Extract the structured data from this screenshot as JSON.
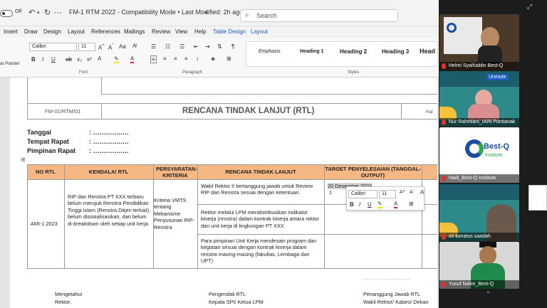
{
  "titlebar": {
    "autosave": "Off",
    "doc_title": "FM-1 RTM 2022  -  Compatibility Mode  •  Last Modified: 2h ago",
    "search_placeholder": "Search"
  },
  "menu": [
    "Insert",
    "Draw",
    "Design",
    "Layout",
    "References",
    "Mailings",
    "Review",
    "View",
    "Help",
    "Table Design",
    "Layout"
  ],
  "ribbon": {
    "format_painter": "at Painter",
    "font_name": "Calibri",
    "font_size": "11",
    "group_font": "Font",
    "group_paragraph": "Paragraph",
    "group_styles": "Styles",
    "styles": [
      "Emphasis",
      "Heading 1",
      "Heading 2",
      "Heading 3",
      "Head"
    ]
  },
  "doc": {
    "form_code": "FM-01/RTM/01",
    "form_title": "RENCANA TINDAK LANJUT (RTL)",
    "hal": "Hal",
    "fields": [
      {
        "label": "Tanggal",
        "value": ": ………….…."
      },
      {
        "label": "Tempat Rapat",
        "value": ": ………….…."
      },
      {
        "label": "Pimpinan Rapat",
        "value": ": ………….…."
      }
    ],
    "headers": [
      "NO RTL",
      "KENDALA/ RTL",
      "PERSYARATAN-KRITERIA",
      "RENCANA TINDAK LANJUT",
      "TARGET PENYELESAIAN (TANGGAL-OUTPUT)"
    ],
    "row": {
      "no": "AMI-1.2023",
      "kendala_1": "RIP dan Renstra PT XXX terbaru belum merujuk Renstra Pendidikan Tinggi Islam (Renstra Ditjen terkait), belum disosialisasikan, dan belum di-",
      "kendala_em": "breakdown",
      "kendala_2": " oleh setiap unit kerja.",
      "kriteria": "Kriteria VMTS tentang Mekanisme Penyusunan RIP-Renstra",
      "rencana": [
        "Wakil Rektor II bertanggung jawab untuk Review RIP dan Renstra sesuai dengan ketentuan.",
        "Rektor melalui LPM mendistribusikan indikator kinerja (renstra) dalam kontrak kinerja antara rektor dan unit kerja di lingkungan PT XXX",
        "Para pimpinan Unit Kerja mendesain program dan kegiatan sesuai dengan kontrak kinerja dalam renstra masing-masing (fakultas, Lembaga dan UPT)"
      ],
      "target": "20 Desember 2023",
      "target_2": "1"
    },
    "dots": "……  ……………………..",
    "signatures": [
      {
        "line1": "Mengetahui",
        "line2": "Rektor,"
      },
      {
        "line1": "Pengendali RTL",
        "line2": "Kepala SPI/ Ketua LPM"
      },
      {
        "line1": "Penanggung Jawab RTL",
        "line2": "Wakil Rektor/ Kabiro/ Dekan"
      }
    ]
  },
  "mini_toolbar": {
    "font_name": "Calibri",
    "font_size": "11"
  },
  "participants": [
    {
      "name": "Helmi Syaifuddin Best-Q"
    },
    {
      "name": "Nur Rahmiani_IAIN Pontianak",
      "tag": "Unmute"
    },
    {
      "name": "Hadi_Best-Q Institute",
      "logo_main": "Best-Q",
      "logo_sub": "Institute"
    },
    {
      "name": "sri lumatus saadah"
    },
    {
      "name": "Yusuf Nalim_Best-Q"
    }
  ],
  "colors": {
    "table_header": "#f5b784",
    "accent": "#1d5fbf",
    "panel": "#1c1c1c",
    "best_q": "#1b4ea0"
  }
}
